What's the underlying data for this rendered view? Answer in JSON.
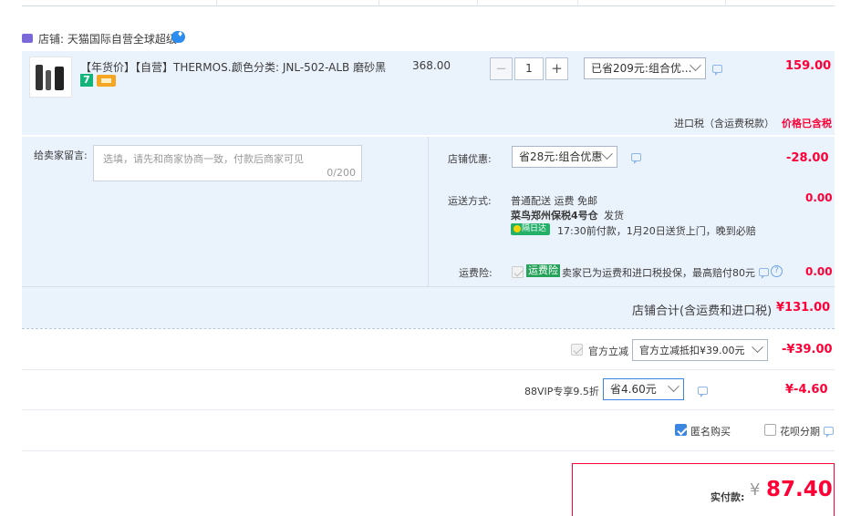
{
  "store": {
    "label": "店铺: 天猫国际自营全球超级",
    "icon": "store-icon",
    "badge_icon": "wangwang-icon"
  },
  "item": {
    "title": "【年货价】【自营】THERMOS...",
    "attr": "颜色分类: JNL-502-ALB 磨砂黑",
    "price": "368.00",
    "badge_num": "7",
    "quantity": "1",
    "minus": "−",
    "plus": "+",
    "promo_select": "已省209元:组合优...",
    "subtotal": "159.00"
  },
  "tax": {
    "label": "进口税（含运费税款）",
    "value": "价格已含税"
  },
  "message": {
    "label": "给卖家留言:",
    "placeholder": "选填，请先和商家协商一致，付款后商家可见",
    "count": "0/200"
  },
  "shop_discount": {
    "label": "店铺优惠:",
    "select": "省28元:组合优惠",
    "value": "-28.00"
  },
  "shipping": {
    "label": "运送方式:",
    "line1": "普通配送 运费 免邮",
    "line2": "菜鸟郑州保税4号仓",
    "line2b": "发货",
    "badge": "隔日达",
    "line3": "17:30前付款，1月20日送货上门，晚到必赔",
    "value": "0.00"
  },
  "insurance": {
    "label": "运费险:",
    "tag": "运费险",
    "text": "卖家已为运费和进口税投保，最高赔付80元",
    "value": "0.00"
  },
  "store_total": {
    "label": "店铺合计(含运费和进口税)",
    "value": "¥131.00"
  },
  "official": {
    "label": "官方立减",
    "select": "官方立减抵扣¥39.00元",
    "value": "-¥39.00"
  },
  "vip": {
    "label": "88VIP专享9.5折",
    "select": "省4.60元",
    "value": "¥-4.60"
  },
  "options": {
    "anonymous": "匿名购买",
    "huabei": "花呗分期"
  },
  "pay": {
    "label": "实付款:",
    "currency": "¥",
    "amount": "87.40"
  },
  "colors": {
    "accent_red": "#ff0036",
    "panel_blue": "#eaf2fc",
    "checkbox_blue": "#3c86e3"
  }
}
